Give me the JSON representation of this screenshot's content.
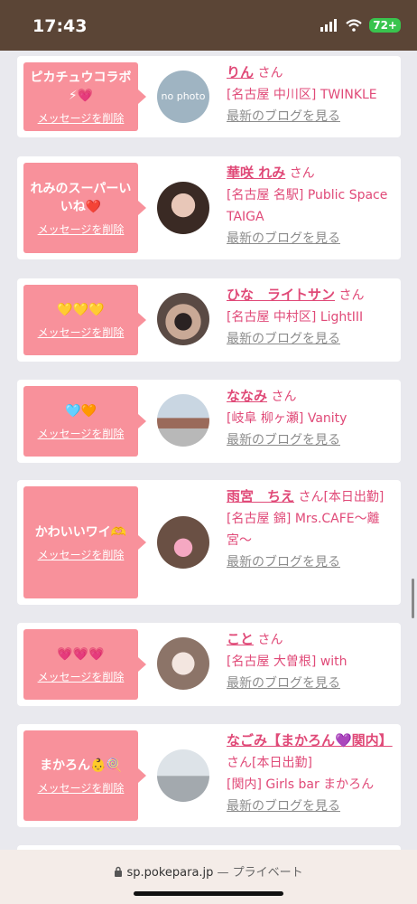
{
  "status_bar": {
    "time": "17:43",
    "battery": "72+"
  },
  "browser": {
    "url": "sp.pokepara.jp",
    "privacy": "— プライベート"
  },
  "colors": {
    "accent": "#e04a78",
    "bubble": "#f8919b",
    "statusbar": "#5b4536"
  },
  "cards": [
    {
      "message": "ピカチュウコラボ⚡💗",
      "delete": "メッセージを削除",
      "name": "りん",
      "san": "さん",
      "shop": "[名古屋 中川区] TWINKLE",
      "blog": "最新のブログを見る",
      "avatar_text": "no photo"
    },
    {
      "message": "れみのスーパーいいね❤️",
      "delete": "メッセージを削除",
      "name": "華咲 れみ",
      "san": "さん",
      "shop": "[名古屋 名駅] Public Space TAIGA",
      "blog": "最新のブログを見る"
    },
    {
      "message": "💛💛💛",
      "delete": "メッセージを削除",
      "name": "ひな　ライトサン",
      "san": "さん",
      "shop": "[名古屋 中村区] LightIII",
      "blog": "最新のブログを見る"
    },
    {
      "message": "🩵🧡",
      "delete": "メッセージを削除",
      "name": "ななみ",
      "san": "さん",
      "shop": "[岐阜 柳ヶ瀬] Vanity",
      "blog": "最新のブログを見る"
    },
    {
      "message": "かわいいワイ🫶",
      "delete": "メッセージを削除",
      "name": "雨宮　ちえ",
      "san": "さん[本日出勤]",
      "shop": "[名古屋 錦] Mrs.CAFE〜離宮〜",
      "blog": "最新のブログを見る"
    },
    {
      "message": "💗💗💗",
      "delete": "メッセージを削除",
      "name": "こと",
      "san": "さん",
      "shop": "[名古屋 大曽根] with",
      "blog": "最新のブログを見る"
    },
    {
      "message": "まかろん👶🍭",
      "delete": "メッセージを削除",
      "name": "なごみ【まかろん💜関内】",
      "san": "さん[本日出勤]",
      "shop": "[関内] Girls bar まかろん",
      "blog": "最新のブログを見る"
    }
  ]
}
